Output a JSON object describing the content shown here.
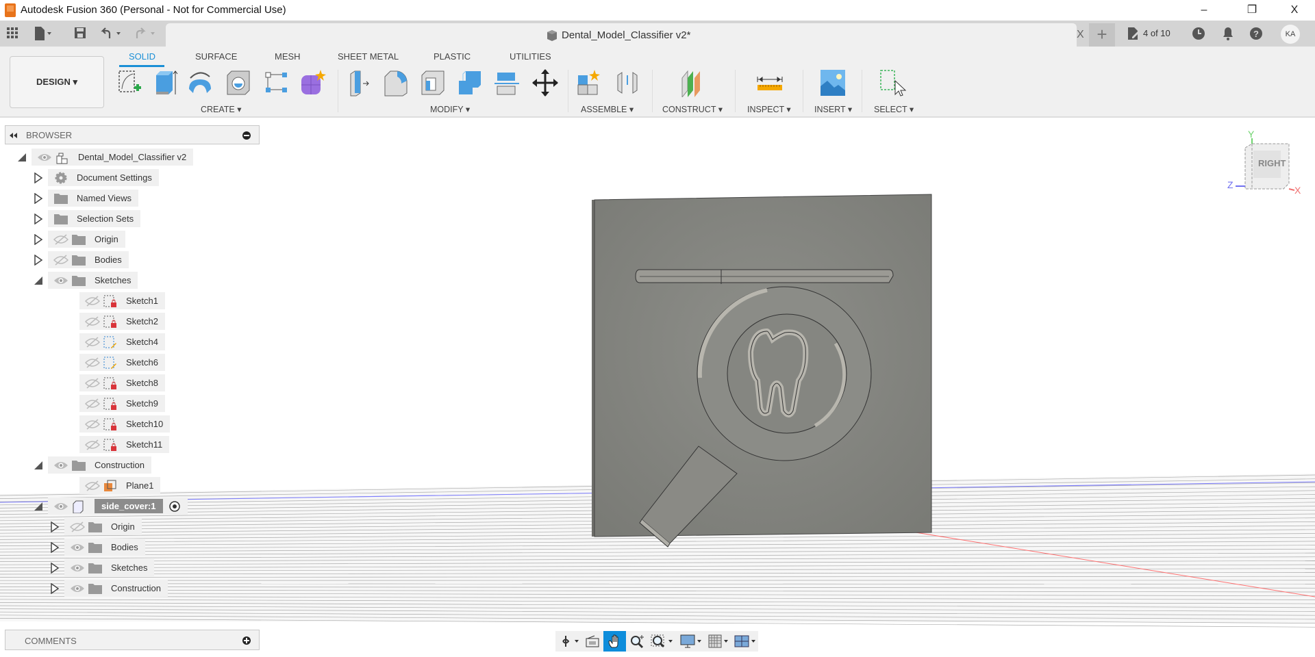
{
  "window": {
    "title": "Autodesk Fusion 360 (Personal - Not for Commercial Use)",
    "minimize": "–",
    "restore": "❐",
    "close": "X"
  },
  "doc_tab": {
    "title": "Dental_Model_Classifier v2*",
    "close": "X",
    "new_tab": "+",
    "job_status": "4 of 10",
    "user_initials": "KA"
  },
  "toolbar": {
    "workspace": "DESIGN ▾",
    "tabs": [
      {
        "label": "SOLID",
        "active": true
      },
      {
        "label": "SURFACE"
      },
      {
        "label": "MESH"
      },
      {
        "label": "SHEET METAL"
      },
      {
        "label": "PLASTIC"
      },
      {
        "label": "UTILITIES"
      }
    ],
    "groups": {
      "create": "CREATE ▾",
      "modify": "MODIFY ▾",
      "assemble": "ASSEMBLE ▾",
      "construct": "CONSTRUCT ▾",
      "inspect": "INSPECT ▾",
      "insert": "INSERT ▾",
      "select": "SELECT ▾"
    }
  },
  "browser": {
    "title": "BROWSER",
    "items": [
      {
        "label": "Dental_Model_Classifier v2",
        "level": 0,
        "toggle": "expanded",
        "eye": "visible",
        "icon": "component"
      },
      {
        "label": "Document Settings",
        "level": 1,
        "toggle": "collapsed",
        "icon": "gear"
      },
      {
        "label": "Named Views",
        "level": 1,
        "toggle": "collapsed",
        "icon": "folder"
      },
      {
        "label": "Selection Sets",
        "level": 1,
        "toggle": "collapsed",
        "icon": "folder"
      },
      {
        "label": "Origin",
        "level": 1,
        "toggle": "collapsed",
        "eye": "hidden",
        "icon": "folder"
      },
      {
        "label": "Bodies",
        "level": 1,
        "toggle": "collapsed",
        "eye": "hidden",
        "icon": "folder"
      },
      {
        "label": "Sketches",
        "level": 1,
        "toggle": "expanded",
        "eye": "visible",
        "icon": "folder"
      },
      {
        "label": "Sketch1",
        "level": 2,
        "eye": "hidden",
        "icon": "sketch-locked"
      },
      {
        "label": "Sketch2",
        "level": 2,
        "eye": "hidden",
        "icon": "sketch-locked"
      },
      {
        "label": "Sketch4",
        "level": 2,
        "eye": "hidden",
        "icon": "sketch-edit"
      },
      {
        "label": "Sketch6",
        "level": 2,
        "eye": "hidden",
        "icon": "sketch-edit"
      },
      {
        "label": "Sketch8",
        "level": 2,
        "eye": "hidden",
        "icon": "sketch-locked"
      },
      {
        "label": "Sketch9",
        "level": 2,
        "eye": "hidden",
        "icon": "sketch-locked"
      },
      {
        "label": "Sketch10",
        "level": 2,
        "eye": "hidden",
        "icon": "sketch-locked"
      },
      {
        "label": "Sketch11",
        "level": 2,
        "eye": "hidden",
        "icon": "sketch-locked"
      },
      {
        "label": "Construction",
        "level": 1,
        "toggle": "expanded",
        "eye": "visible",
        "icon": "folder"
      },
      {
        "label": "Plane1",
        "level": 2,
        "eye": "hidden",
        "icon": "plane"
      },
      {
        "label": "side_cover:1",
        "level": 1,
        "toggle": "expanded",
        "eye": "visible",
        "icon": "body",
        "selected": true,
        "activate": true
      },
      {
        "label": "Origin",
        "level": 2,
        "toggle": "collapsed",
        "eye": "hidden",
        "icon": "folder"
      },
      {
        "label": "Bodies",
        "level": 2,
        "toggle": "collapsed",
        "eye": "visible",
        "icon": "folder"
      },
      {
        "label": "Sketches",
        "level": 2,
        "toggle": "collapsed",
        "eye": "visible",
        "icon": "folder"
      },
      {
        "label": "Construction",
        "level": 2,
        "toggle": "collapsed",
        "eye": "visible",
        "icon": "folder"
      }
    ]
  },
  "viewcube": {
    "face": "RIGHT",
    "axes": {
      "x": "X",
      "y": "Y",
      "z": "Z"
    },
    "colors": {
      "x": "#f07070",
      "y": "#6fd46f",
      "z": "#7070f0"
    }
  },
  "comments": {
    "title": "COMMENTS"
  },
  "navbar": {
    "active": "pan"
  },
  "colors": {
    "accent": "#1a8fd6",
    "model": "#8a8a86"
  }
}
